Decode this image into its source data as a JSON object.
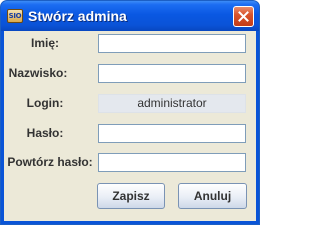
{
  "window": {
    "icon_text": "SIO",
    "title": "Stwórz admina"
  },
  "form": {
    "name_label": "Imię:",
    "name_value": "",
    "surname_label": "Nazwisko:",
    "surname_value": "",
    "login_label": "Login:",
    "login_value": "administrator",
    "password_label": "Hasło:",
    "password_value": "",
    "repeat_password_label": "Powtórz hasło:",
    "repeat_password_value": ""
  },
  "buttons": {
    "save_label": "Zapisz",
    "cancel_label": "Anuluj"
  },
  "colors": {
    "title_bar": "#0a53d8",
    "close_button": "#d9542c",
    "client_background": "#ece9d8",
    "field_border": "#7f9db9"
  },
  "icons": [
    "app-icon",
    "close-icon"
  ]
}
